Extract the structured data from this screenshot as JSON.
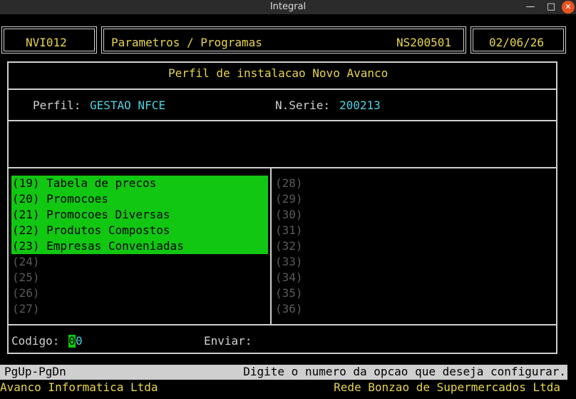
{
  "window": {
    "title": "Integral"
  },
  "header": {
    "code": "NVI012",
    "section": "Parametros / Programas",
    "serial": "NS200501",
    "date": "02/06/26"
  },
  "panel_title": "Perfil de instalacao Novo Avanco",
  "profile": {
    "perfil_label": "Perfil:",
    "perfil_value": "GESTAO NFCE",
    "serie_label": "N.Serie:",
    "serie_value": "200213"
  },
  "menu_left": [
    {
      "label": "(19) Tabela de precos",
      "selected": true
    },
    {
      "label": "(20) Promocoes",
      "selected": true
    },
    {
      "label": "(21) Promocoes Diversas",
      "selected": true
    },
    {
      "label": "(22) Produtos Compostos",
      "selected": true
    },
    {
      "label": "(23) Empresas Conveniadas",
      "selected": true
    },
    {
      "label": "(24)",
      "selected": false
    },
    {
      "label": "(25)",
      "selected": false
    },
    {
      "label": "(26)",
      "selected": false
    },
    {
      "label": "(27)",
      "selected": false
    }
  ],
  "menu_right": [
    {
      "label": "(28)"
    },
    {
      "label": "(29)"
    },
    {
      "label": "(30)"
    },
    {
      "label": "(31)"
    },
    {
      "label": "(32)"
    },
    {
      "label": "(33)"
    },
    {
      "label": "(34)"
    },
    {
      "label": "(35)"
    },
    {
      "label": "(36)"
    }
  ],
  "input": {
    "codigo_label": "Codigo:",
    "codigo_cursor": "0",
    "codigo_rest": "0",
    "enviar_label": "Enviar:"
  },
  "status": {
    "keys": "PgUp-PgDn",
    "message": "Digite o numero da opcao que deseja configurar."
  },
  "footer": {
    "left": "Avanco Informatica Ltda",
    "right": "Rede Bonzao de Supermercados Ltda"
  },
  "colors": {
    "accent_green": "#11c711",
    "label_yellow": "#e6d64a",
    "value_cyan": "#4fd2e3"
  }
}
